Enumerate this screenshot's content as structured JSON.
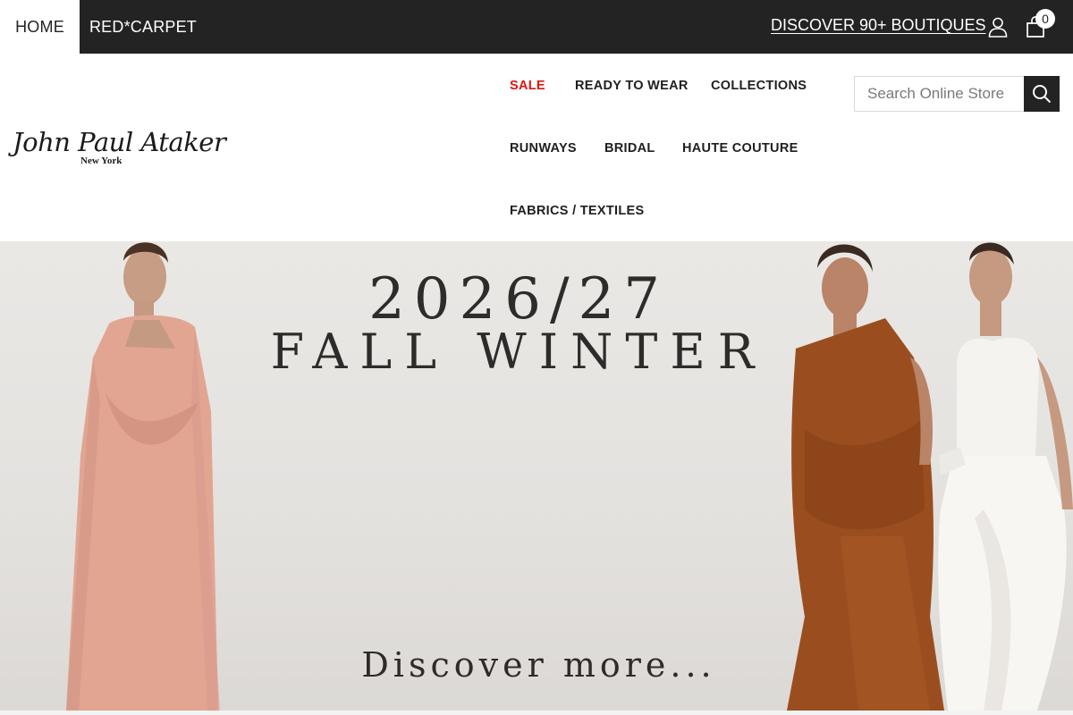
{
  "topbar": {
    "home_label": "HOME",
    "redcarpet_label": "RED*CARPET",
    "discover_label": "DISCOVER 90+ BOUTIQUES",
    "cart_count": "0",
    "icons": {
      "account": "user-icon",
      "cart": "shopping-bag-icon"
    }
  },
  "brand": {
    "name": "John Paul Ataker",
    "location": "New York"
  },
  "nav": {
    "sale": "SALE",
    "ready_to_wear": "READY TO WEAR",
    "collections": "COLLECTIONS",
    "runways": "RUNWAYS",
    "bridal": "BRIDAL",
    "haute_couture": "HAUTE COUTURE",
    "fabrics": "FABRICS / TEXTILES"
  },
  "search": {
    "placeholder": "Search Online Store",
    "value": "",
    "icon": "search-icon"
  },
  "hero": {
    "year": "2026/27",
    "season": "FALL WINTER",
    "cta": "Discover more..."
  },
  "colors": {
    "topbar": "#232323",
    "sale": "#e0140d",
    "accent_dress_pink": "#e0a28f",
    "accent_dress_rust": "#9a4e1f"
  }
}
